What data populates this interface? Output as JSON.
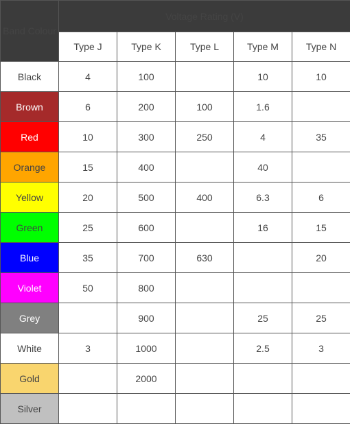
{
  "header": {
    "band_colour": "Band Colour",
    "voltage_rating": "Voltage Rating (V)",
    "types": [
      "Type J",
      "Type K",
      "Type L",
      "Type M",
      "Type N"
    ]
  },
  "rows": [
    {
      "band": "Black",
      "bg": "#ffffff",
      "fg": "#444444",
      "values": [
        "4",
        "100",
        "",
        "10",
        "10"
      ]
    },
    {
      "band": "Brown",
      "bg": "#a52a2a",
      "fg": "#ffffff",
      "values": [
        "6",
        "200",
        "100",
        "1.6",
        ""
      ]
    },
    {
      "band": "Red",
      "bg": "#ff0000",
      "fg": "#ffffff",
      "values": [
        "10",
        "300",
        "250",
        "4",
        "35"
      ]
    },
    {
      "band": "Orange",
      "bg": "#ffa500",
      "fg": "#444444",
      "values": [
        "15",
        "400",
        "",
        "40",
        ""
      ]
    },
    {
      "band": "Yellow",
      "bg": "#ffff00",
      "fg": "#444444",
      "values": [
        "20",
        "500",
        "400",
        "6.3",
        "6"
      ]
    },
    {
      "band": "Green",
      "bg": "#00ff00",
      "fg": "#444444",
      "values": [
        "25",
        "600",
        "",
        "16",
        "15"
      ]
    },
    {
      "band": "Blue",
      "bg": "#0000ff",
      "fg": "#ffffff",
      "values": [
        "35",
        "700",
        "630",
        "",
        "20"
      ]
    },
    {
      "band": "Violet",
      "bg": "#ff00ff",
      "fg": "#ffffff",
      "values": [
        "50",
        "800",
        "",
        "",
        ""
      ]
    },
    {
      "band": "Grey",
      "bg": "#808080",
      "fg": "#ffffff",
      "values": [
        "",
        "900",
        "",
        "25",
        "25"
      ]
    },
    {
      "band": "White",
      "bg": "#ffffff",
      "fg": "#444444",
      "values": [
        "3",
        "1000",
        "",
        "2.5",
        "3"
      ]
    },
    {
      "band": "Gold",
      "bg": "#f9d56e",
      "fg": "#444444",
      "values": [
        "",
        "2000",
        "",
        "",
        ""
      ]
    },
    {
      "band": "Silver",
      "bg": "#c0c0c0",
      "fg": "#444444",
      "values": [
        "",
        "",
        "",
        "",
        ""
      ]
    }
  ]
}
